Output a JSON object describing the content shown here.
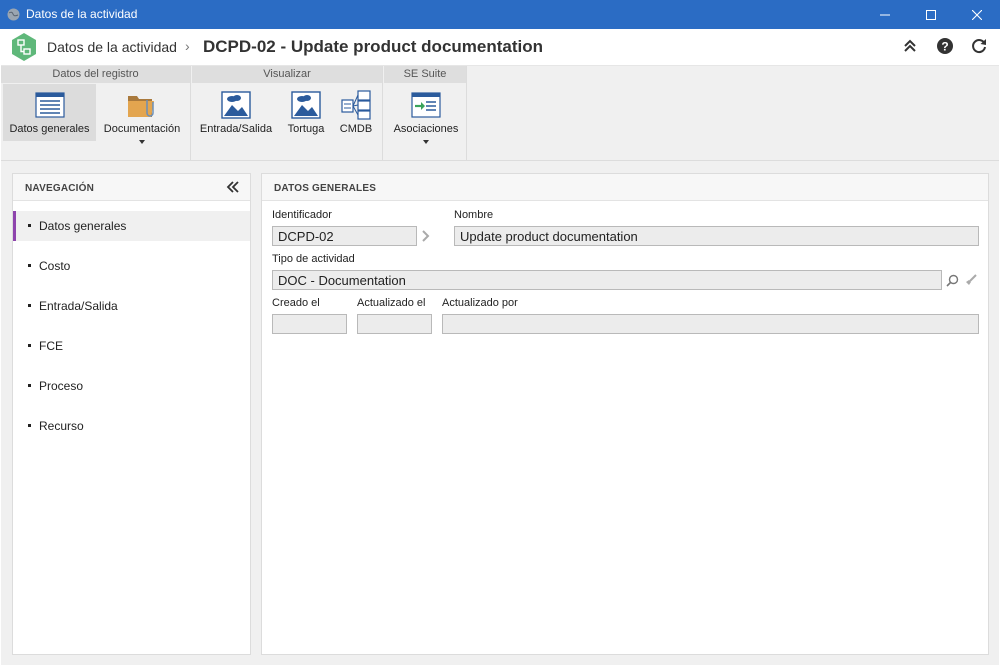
{
  "window": {
    "title": "Datos de la actividad"
  },
  "header": {
    "breadcrumb": "Datos de la actividad",
    "separator": "›",
    "record_title": "DCPD-02 - Update product documentation"
  },
  "ribbon": {
    "groups": [
      {
        "title": "Datos del registro",
        "buttons": [
          {
            "label": "Datos generales",
            "active": true
          },
          {
            "label": "Documentación",
            "has_dropdown": true
          }
        ]
      },
      {
        "title": "Visualizar",
        "buttons": [
          {
            "label": "Entrada/Salida"
          },
          {
            "label": "Tortuga"
          },
          {
            "label": "CMDB"
          }
        ]
      },
      {
        "title": "SE Suite",
        "buttons": [
          {
            "label": "Asociaciones",
            "has_dropdown": true
          }
        ]
      }
    ]
  },
  "navigation": {
    "title": "NAVEGACIÓN",
    "items": [
      {
        "label": "Datos generales",
        "active": true
      },
      {
        "label": "Costo"
      },
      {
        "label": "Entrada/Salida"
      },
      {
        "label": "FCE"
      },
      {
        "label": "Proceso"
      },
      {
        "label": "Recurso"
      }
    ]
  },
  "form": {
    "title": "DATOS GENERALES",
    "identificador": {
      "label": "Identificador",
      "value": "DCPD-02"
    },
    "nombre": {
      "label": "Nombre",
      "value": "Update product documentation"
    },
    "tipo": {
      "label": "Tipo de actividad",
      "value": "DOC - Documentation"
    },
    "creado": {
      "label": "Creado el",
      "value": ""
    },
    "actualizado": {
      "label": "Actualizado el",
      "value": ""
    },
    "actualizado_por": {
      "label": "Actualizado por",
      "value": ""
    }
  },
  "colors": {
    "titlebar": "#2b6cc4",
    "nav_active_accent": "#8e44ad",
    "logo": "#5fb87a"
  }
}
